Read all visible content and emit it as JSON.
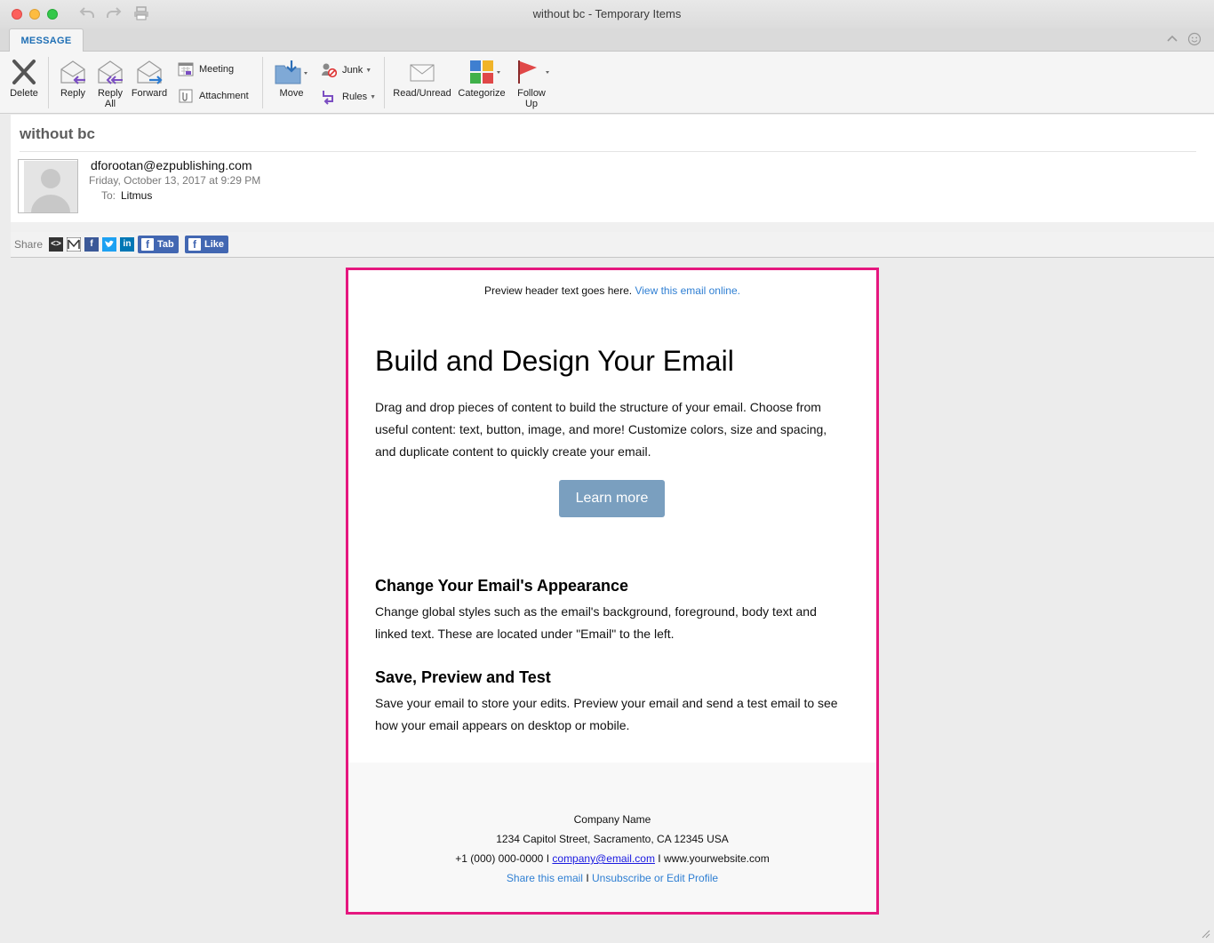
{
  "window": {
    "title": "without bc - Temporary Items"
  },
  "tabs": [
    {
      "label": "MESSAGE"
    }
  ],
  "ribbon": {
    "delete": "Delete",
    "reply": "Reply",
    "reply_all_1": "Reply",
    "reply_all_2": "All",
    "forward": "Forward",
    "meeting": "Meeting",
    "attachment": "Attachment",
    "move": "Move",
    "junk": "Junk",
    "rules": "Rules",
    "read_unread": "Read/Unread",
    "categorize": "Categorize",
    "follow_up_1": "Follow",
    "follow_up_2": "Up"
  },
  "message": {
    "subject": "without bc",
    "sender": "dforootan@ezpublishing.com",
    "date": "Friday, October 13, 2017 at 9:29 PM",
    "to_label": "To:",
    "to": "Litmus"
  },
  "share": {
    "label": "Share",
    "tab_button": "Tab",
    "like_button": "Like"
  },
  "email": {
    "preview_text": "Preview header text goes here.",
    "preview_link": "View this email online.",
    "heading": "Build and Design Your Email",
    "intro_lines": [
      "Drag and drop pieces of content to build the structure of your email. Choose from",
      "useful content: text, button, image, and more! Customize colors, size and spacing,",
      "and duplicate content to quickly create your email."
    ],
    "cta": "Learn more",
    "section1_title": "Change Your Email's Appearance",
    "section1_lines": [
      "Change global styles such as the email's background, foreground, body text and",
      "linked text. These are located under \"Email\" to the left."
    ],
    "section2_title": "Save, Preview and Test",
    "section2_lines": [
      "Save your email to store your edits. Preview your email and send a test email to see",
      "how your email appears on desktop or mobile."
    ],
    "footer": {
      "company": "Company Name",
      "address": "1234 Capitol Street, Sacramento, CA 12345 USA",
      "phone": "+1 (000) 000-0000",
      "sep1": "I",
      "email": "company@email.com",
      "sep2": "I",
      "website": "www.yourwebsite.com",
      "share_link": "Share this email",
      "sep3": "I",
      "unsubscribe_link": "Unsubscribe or Edit Profile"
    }
  },
  "colors": {
    "accent_blue": "#1f6fb5",
    "link_blue": "#2f7fd3",
    "highlight_border": "#e5177f",
    "cta_bg": "#7a9fbf",
    "facebook": "#4267b2"
  }
}
